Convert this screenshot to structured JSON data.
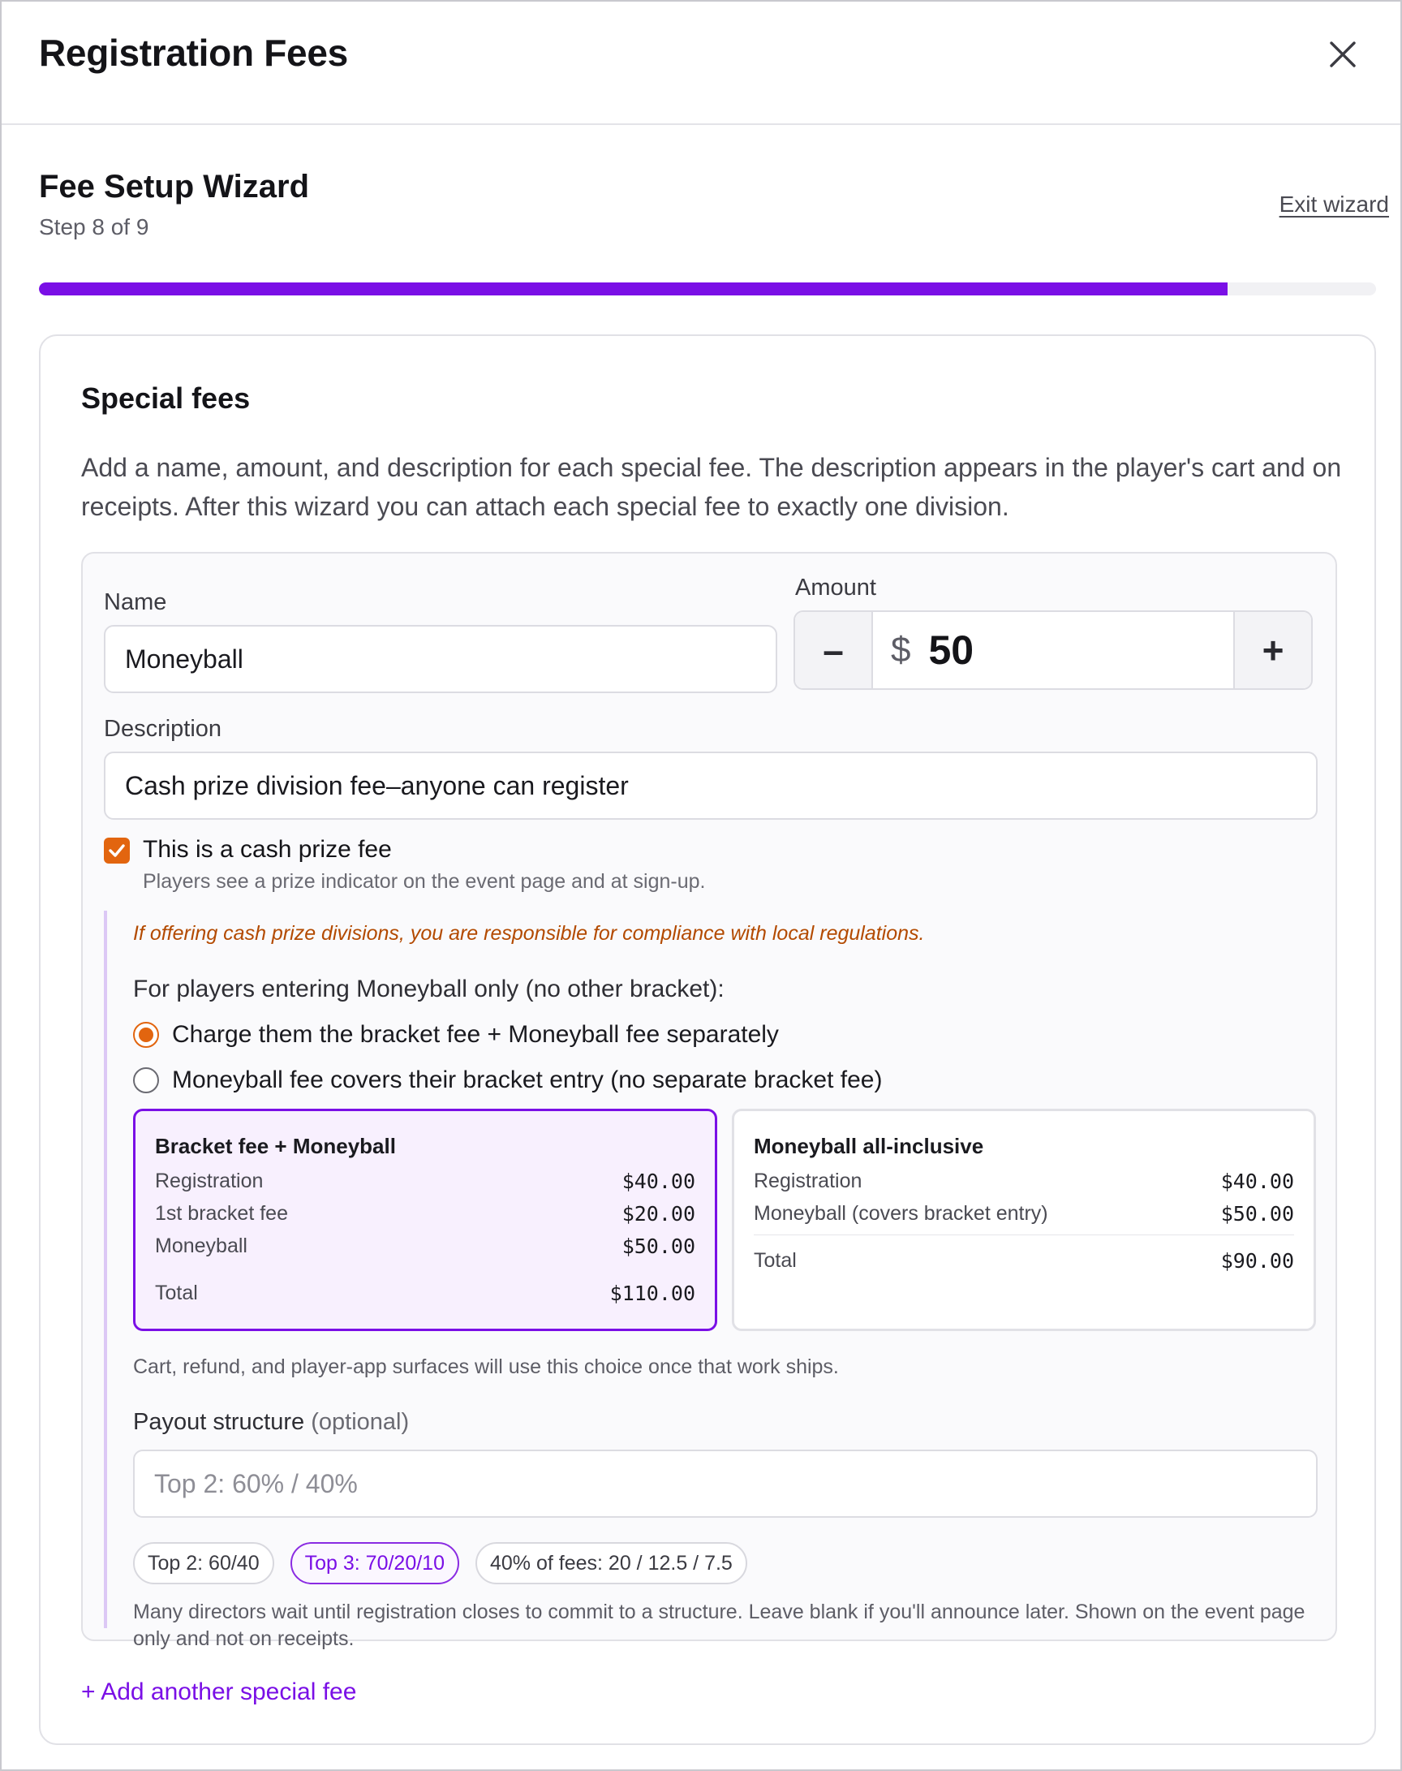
{
  "modal": {
    "title": "Registration Fees",
    "close_icon": "close-icon"
  },
  "wizard": {
    "title": "Fee Setup Wizard",
    "step_text": "Step 8 of 9",
    "exit_label": "Exit wizard",
    "progress_fraction": 0.889,
    "accent": "#7a0fe6"
  },
  "section": {
    "title": "Special fees",
    "description": "Add a name, amount, and description for each special fee. The description appears in the player's cart and on receipts. After this wizard you can attach each special fee to exactly one division."
  },
  "fee": {
    "name_label": "Name",
    "name_value": "Moneyball",
    "amount_label": "Amount",
    "amount_currency": "$",
    "amount_value": "50",
    "decrement_label": "–",
    "increment_label": "+",
    "description_label": "Description",
    "description_value": "Cash prize division fee–anyone can register",
    "cash_prize_checked": true,
    "cash_prize_label": "This is a cash prize fee",
    "cash_prize_hint": "Players see a prize indicator on the event page and at sign-up.",
    "warning": "If offering cash prize divisions, you are responsible for compliance with local regulations.",
    "question": "For players entering Moneyball only (no other bracket):",
    "radio_options": [
      {
        "label": "Charge them the bracket fee + Moneyball fee separately",
        "selected": true
      },
      {
        "label": "Moneyball fee covers their bracket entry (no separate bracket fee)",
        "selected": false
      }
    ],
    "option_cards": [
      {
        "title": "Bracket fee + Moneyball",
        "rows": [
          {
            "label": "Registration",
            "value": "$40.00"
          },
          {
            "label": "1st bracket fee",
            "value": "$20.00"
          },
          {
            "label": "Moneyball",
            "value": "$50.00"
          }
        ],
        "total_label": "Total",
        "total_value": "$110.00"
      },
      {
        "title": "Moneyball all-inclusive",
        "rows": [
          {
            "label": "Registration",
            "value": "$40.00"
          },
          {
            "label": "Moneyball (covers bracket entry)",
            "value": "$50.00"
          }
        ],
        "total_label": "Total",
        "total_value": "$90.00"
      }
    ],
    "surface_note": "Cart, refund, and player-app surfaces will use this choice once that work ships.",
    "payout_label": "Payout structure",
    "payout_optional": "(optional)",
    "payout_placeholder": "Top 2: 60% / 40%",
    "payout_chips": [
      {
        "label": "Top 2: 60/40",
        "active": false
      },
      {
        "label": "Top 3: 70/20/10",
        "active": true
      },
      {
        "label": "40% of fees: 20 / 12.5 / 7.5",
        "active": false
      }
    ],
    "payout_hint": "Many directors wait until registration closes to commit to a structure. Leave blank if you'll announce later. Shown on the event page only and not on receipts."
  },
  "add_another_label": "+ Add another special fee"
}
